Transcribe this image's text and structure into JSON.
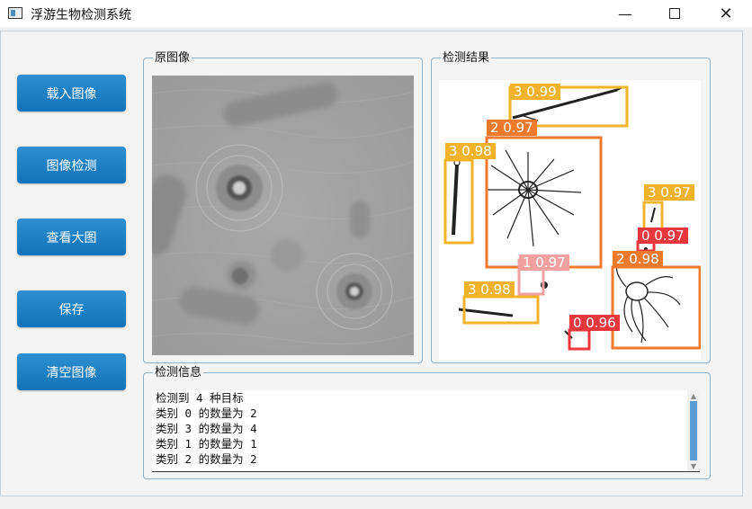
{
  "window": {
    "title": "浮游生物检测系统",
    "minimize_icon": "minimize-icon",
    "maximize_icon": "maximize-icon",
    "close_icon": "close-icon"
  },
  "buttons": {
    "load": "载入图像",
    "detect": "图像检测",
    "view_large": "查看大图",
    "save": "保存",
    "clear": "清空图像"
  },
  "panels": {
    "original_title": "原图像",
    "result_title": "检测结果",
    "info_title": "检测信息"
  },
  "detections": [
    {
      "label": "3 0.99",
      "color": "#f2b32a"
    },
    {
      "label": "2 0.97",
      "color": "#ef7a2e"
    },
    {
      "label": "3 0.98",
      "color": "#f2b32a"
    },
    {
      "label": "3 0.97",
      "color": "#f2b32a"
    },
    {
      "label": "0 0.97",
      "color": "#e8383d"
    },
    {
      "label": "2 0.98",
      "color": "#ef7a2e"
    },
    {
      "label": "1 0.97",
      "color": "#f2a0a0"
    },
    {
      "label": "3 0.98",
      "color": "#f2b32a"
    },
    {
      "label": "0 0.96",
      "color": "#e8383d"
    }
  ],
  "info": {
    "lines": [
      "检测到 4 种目标",
      "类别 0 的数量为 2",
      "类别 3 的数量为 4",
      "类别 1 的数量为 1",
      "类别 2 的数量为 2"
    ]
  },
  "colors": {
    "button": "#1a7dc4",
    "group_border": "#8fb2cf",
    "scroll_thumb": "#5b9bd5"
  }
}
